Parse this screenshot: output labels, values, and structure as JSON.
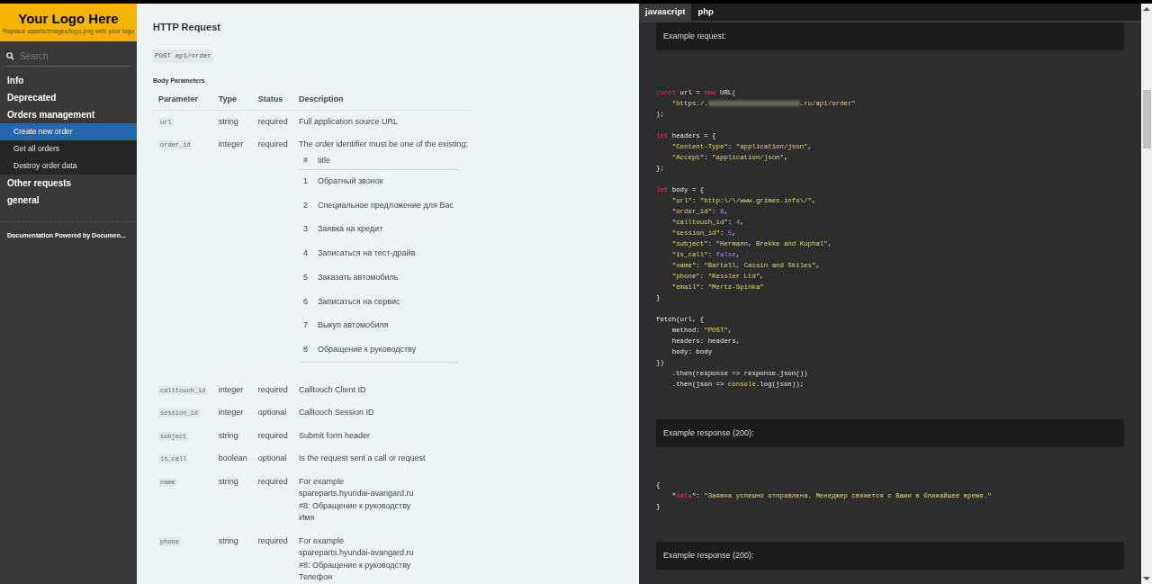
{
  "sidebar": {
    "logo": {
      "title": "Your Logo Here",
      "subtitle": "Replace assets/images/logo.png with your logo"
    },
    "search": {
      "placeholder": "Search"
    },
    "items": [
      {
        "label": "Info",
        "selected": false
      },
      {
        "label": "Deprecated",
        "selected": false
      },
      {
        "label": "Orders management",
        "selected": false,
        "children": [
          {
            "label": "Create new order",
            "selected": true
          },
          {
            "label": "Get all orders",
            "selected": false
          },
          {
            "label": "Destroy order data",
            "selected": false
          }
        ]
      },
      {
        "label": "Other requests",
        "selected": false
      },
      {
        "label": "general",
        "selected": false
      }
    ],
    "footer": "Documentation Powered by Documen..."
  },
  "content": {
    "heading": "HTTP Request",
    "endpoint": "POST api/order",
    "section": "Body Parameters",
    "table": {
      "columns": [
        "Parameter",
        "Type",
        "Status",
        "Description"
      ],
      "rows": [
        {
          "parameter": "url",
          "type": "string",
          "status": "required",
          "description": [
            "Full application source URL"
          ]
        },
        {
          "parameter": "order_id",
          "type": "integer",
          "status": "required",
          "description": [
            "The order identifier must be one of the existing:"
          ],
          "subtable": {
            "columns": [
              "#",
              "title"
            ],
            "rows": [
              [
                "1",
                "Обратный звонок"
              ],
              [
                "2",
                "Специальное предложение для Вас"
              ],
              [
                "3",
                "Заявка на кредит"
              ],
              [
                "4",
                "Записаться на тест-драйв"
              ],
              [
                "5",
                "Заказать автомобиль"
              ],
              [
                "6",
                "Записаться на сервис"
              ],
              [
                "7",
                "Выкуп автомобиля"
              ],
              [
                "8",
                "Обращение к руководству"
              ]
            ]
          }
        },
        {
          "parameter": "calltouch_id",
          "type": "integer",
          "status": "required",
          "description": [
            "Calltouch Client ID"
          ]
        },
        {
          "parameter": "session_id",
          "type": "integer",
          "status": "optional",
          "description": [
            "Calltouch Session ID"
          ]
        },
        {
          "parameter": "subject",
          "type": "string",
          "status": "required",
          "description": [
            "Submit form header"
          ]
        },
        {
          "parameter": "is_call",
          "type": "boolean",
          "status": "optional",
          "description": [
            "Is the request sent a call or request"
          ]
        },
        {
          "parameter": "name",
          "type": "string",
          "status": "required",
          "description": [
            "For example",
            "spareparts.hyundai-avangard.ru",
            "#8: Обращение к руководству",
            "Имя"
          ]
        },
        {
          "parameter": "phone",
          "type": "string",
          "status": "required",
          "description": [
            "For example",
            "spareparts.hyundai-avangard.ru",
            "#8: Обращение к руководству",
            "Телефон"
          ]
        }
      ]
    }
  },
  "code_panel": {
    "tabs": [
      {
        "label": "javascript",
        "selected": true
      },
      {
        "label": "php",
        "selected": false
      }
    ],
    "sections": [
      {
        "kind": "note",
        "text": "Example request:"
      },
      {
        "kind": "code",
        "blocks": [
          [
            [
              {
                "kind": "keyword",
                "text": "const"
              },
              {
                "kind": "plain",
                "text": " url = "
              },
              {
                "kind": "keyword",
                "text": "new"
              },
              {
                "kind": "plain",
                "text": " URL("
              }
            ],
            [
              {
                "kind": "string",
                "text": "    \"https:/."
              },
              {
                "kind": "redacted"
              },
              {
                "kind": "string",
                "text": ".ru/api/order\""
              }
            ],
            [
              {
                "kind": "plain",
                "text": ");"
              }
            ]
          ],
          [
            [
              {
                "kind": "keyword",
                "text": "let"
              },
              {
                "kind": "plain",
                "text": " headers = {"
              }
            ],
            [
              {
                "kind": "string",
                "text": "    \"Content-Type\""
              },
              {
                "kind": "plain",
                "text": ": "
              },
              {
                "kind": "string",
                "text": "\"application/json\""
              },
              {
                "kind": "plain",
                "text": ","
              }
            ],
            [
              {
                "kind": "string",
                "text": "    \"Accept\""
              },
              {
                "kind": "plain",
                "text": ": "
              },
              {
                "kind": "string",
                "text": "\"application/json\""
              },
              {
                "kind": "plain",
                "text": ","
              }
            ],
            [
              {
                "kind": "plain",
                "text": "};"
              }
            ]
          ],
          [
            [
              {
                "kind": "keyword",
                "text": "let"
              },
              {
                "kind": "plain",
                "text": " body = {"
              }
            ],
            [
              {
                "kind": "string",
                "text": "    \"url\""
              },
              {
                "kind": "plain",
                "text": ": "
              },
              {
                "kind": "string",
                "text": "\"http:\\/\\/www.grimes.info\\/\""
              },
              {
                "kind": "plain",
                "text": ","
              }
            ],
            [
              {
                "kind": "string",
                "text": "    \"order_id\""
              },
              {
                "kind": "plain",
                "text": ": "
              },
              {
                "kind": "number",
                "text": "8"
              },
              {
                "kind": "plain",
                "text": ","
              }
            ],
            [
              {
                "kind": "string",
                "text": "    \"calltouch_id\""
              },
              {
                "kind": "plain",
                "text": ": "
              },
              {
                "kind": "number",
                "text": "4"
              },
              {
                "kind": "plain",
                "text": ","
              }
            ],
            [
              {
                "kind": "string",
                "text": "    \"session_id\""
              },
              {
                "kind": "plain",
                "text": ": "
              },
              {
                "kind": "number",
                "text": "5"
              },
              {
                "kind": "plain",
                "text": ","
              }
            ],
            [
              {
                "kind": "string",
                "text": "    \"subject\""
              },
              {
                "kind": "plain",
                "text": ": "
              },
              {
                "kind": "string",
                "text": "\"Hermann, Brekke and Kuphal\""
              },
              {
                "kind": "plain",
                "text": ","
              }
            ],
            [
              {
                "kind": "string",
                "text": "    \"is_call\""
              },
              {
                "kind": "plain",
                "text": ": "
              },
              {
                "kind": "number",
                "text": "false"
              },
              {
                "kind": "plain",
                "text": ","
              }
            ],
            [
              {
                "kind": "string",
                "text": "    \"name\""
              },
              {
                "kind": "plain",
                "text": ": "
              },
              {
                "kind": "string",
                "text": "\"Bartell, Cassin and Skiles\""
              },
              {
                "kind": "plain",
                "text": ","
              }
            ],
            [
              {
                "kind": "string",
                "text": "    \"phone\""
              },
              {
                "kind": "plain",
                "text": ": "
              },
              {
                "kind": "string",
                "text": "\"Kessler Ltd\""
              },
              {
                "kind": "plain",
                "text": ","
              }
            ],
            [
              {
                "kind": "string",
                "text": "    \"email\""
              },
              {
                "kind": "plain",
                "text": ": "
              },
              {
                "kind": "string",
                "text": "\"Mertz-Spinka\""
              }
            ],
            [
              {
                "kind": "plain",
                "text": "}"
              }
            ]
          ],
          [
            [
              {
                "kind": "plain",
                "text": "fetch(url, {"
              }
            ],
            [
              {
                "kind": "plain",
                "text": "    method: "
              },
              {
                "kind": "string",
                "text": "\"POST\""
              },
              {
                "kind": "plain",
                "text": ","
              }
            ],
            [
              {
                "kind": "plain",
                "text": "    headers: headers,"
              }
            ],
            [
              {
                "kind": "plain",
                "text": "    body: body"
              }
            ],
            [
              {
                "kind": "plain",
                "text": "})"
              }
            ],
            [
              {
                "kind": "plain",
                "text": "    .then(response => response.json())"
              }
            ],
            [
              {
                "kind": "plain",
                "text": "    .then(json => "
              },
              {
                "kind": "string",
                "text": "console"
              },
              {
                "kind": "plain",
                "text": ".log(json));"
              }
            ]
          ]
        ]
      },
      {
        "kind": "note",
        "text": "Example response (200):"
      },
      {
        "kind": "code",
        "blocks": [
          [
            [
              {
                "kind": "plain",
                "text": "{"
              }
            ],
            [
              {
                "kind": "plain",
                "text": "    \""
              },
              {
                "kind": "keyword",
                "text": "data"
              },
              {
                "kind": "plain",
                "text": "\": "
              },
              {
                "kind": "string",
                "text": "\"Заявка успешно отправлена. Менеджер свяжется с Вами в ближайшее время.\""
              }
            ],
            [
              {
                "kind": "plain",
                "text": "}"
              }
            ]
          ]
        ]
      },
      {
        "kind": "note",
        "text": "Example response (200):"
      }
    ]
  }
}
